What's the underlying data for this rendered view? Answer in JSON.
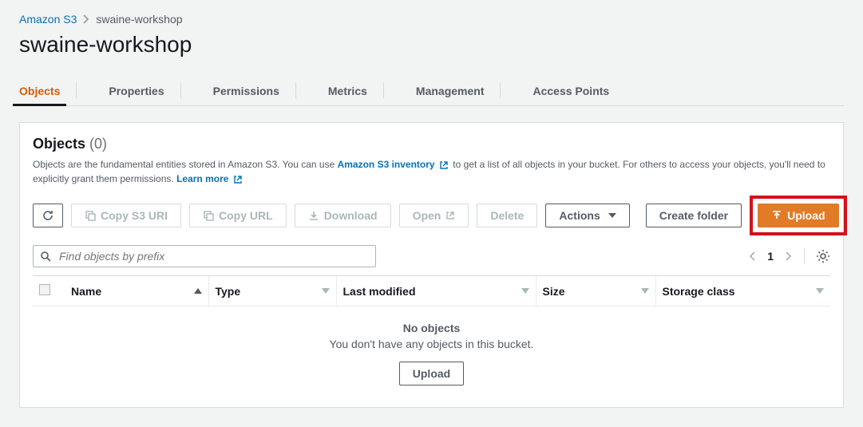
{
  "breadcrumb": {
    "root": "Amazon S3",
    "current": "swaine-workshop"
  },
  "page_title": "swaine-workshop",
  "tabs": [
    "Objects",
    "Properties",
    "Permissions",
    "Metrics",
    "Management",
    "Access Points"
  ],
  "panel": {
    "title": "Objects",
    "count": "(0)",
    "desc_1": "Objects are the fundamental entities stored in Amazon S3. You can use ",
    "desc_link1": "Amazon S3 inventory",
    "desc_2": " to get a list of all objects in your bucket. For others to access your objects, you'll need to explicitly grant them permissions. ",
    "desc_link2": "Learn more"
  },
  "toolbar": {
    "copy_uri": "Copy S3 URI",
    "copy_url": "Copy URL",
    "download": "Download",
    "open": "Open",
    "delete": "Delete",
    "actions": "Actions",
    "create_folder": "Create folder",
    "upload": "Upload"
  },
  "search": {
    "placeholder": "Find objects by prefix"
  },
  "pagination": {
    "current": "1"
  },
  "columns": {
    "name": "Name",
    "type": "Type",
    "last_modified": "Last modified",
    "size": "Size",
    "storage_class": "Storage class"
  },
  "empty_state": {
    "title": "No objects",
    "subtitle": "You don't have any objects in this bucket.",
    "button": "Upload"
  }
}
